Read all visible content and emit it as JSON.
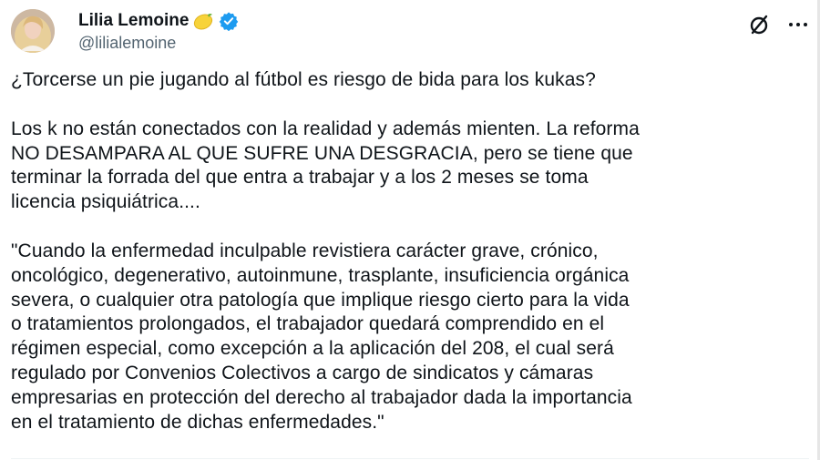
{
  "user": {
    "display_name": "Lilia Lemoine",
    "handle": "@lilialemoine",
    "name_emoji_icon": "lemon-icon",
    "verified_icon": "verified-badge-icon"
  },
  "header": {
    "grok_icon": "grok-slash-icon",
    "more_icon": "more-dots-icon"
  },
  "tweet": {
    "para1": "¿Torcerse un pie jugando al fútbol es riesgo de bida para los kukas?",
    "para2_lines": [
      "Los k no están conectados con la realidad y además mienten. La reforma",
      "NO DESAMPARA AL QUE SUFRE UNA DESGRACIA, pero se tiene que",
      "terminar la forrada del que entra a trabajar y a los 2 meses se toma",
      "licencia psiquiátrica...."
    ],
    "para3_lines": [
      "\"Cuando la enfermedad inculpable revistiera carácter grave, crónico,",
      "oncológico, degenerativo, autoinmune, trasplante, insuficiencia orgánica",
      "severa, o cualquier otra patología que implique riesgo cierto para la vida",
      "o tratamientos prolongados, el trabajador quedará comprendido en el",
      "régimen especial, como excepción a la aplicación del 208, el cual será",
      "regulado por Convenios Colectivos a cargo de sindicatos y cámaras",
      "empresarias en protección del derecho al trabajador dada la importancia",
      "en el tratamiento de dichas enfermedades.\""
    ]
  },
  "colors": {
    "text": "#0f1419",
    "secondary": "#536471",
    "verified": "#1d9bf0"
  }
}
